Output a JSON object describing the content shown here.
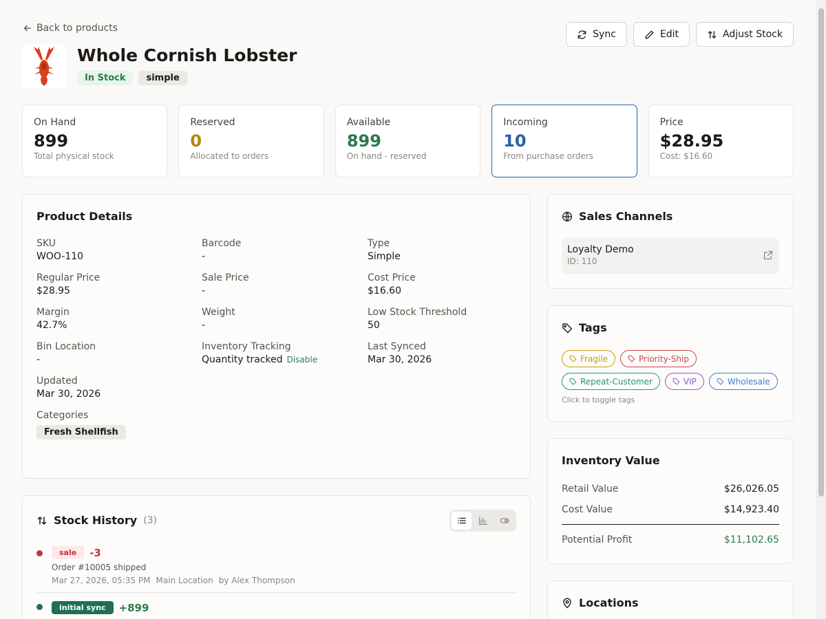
{
  "nav": {
    "back_label": "Back to products"
  },
  "actions": {
    "sync": "Sync",
    "edit": "Edit",
    "adjust": "Adjust Stock"
  },
  "product": {
    "name": "Whole Cornish Lobster",
    "status": "In Stock",
    "type_badge": "simple"
  },
  "stats": [
    {
      "label": "On Hand",
      "value": "899",
      "sub": "Total physical stock",
      "color": "#1c1917"
    },
    {
      "label": "Reserved",
      "value": "0",
      "sub": "Allocated to orders",
      "color": "#b8860b"
    },
    {
      "label": "Available",
      "value": "899",
      "sub": "On hand - reserved",
      "color": "#2b7a4b"
    },
    {
      "label": "Incoming",
      "value": "10",
      "sub": "From purchase orders",
      "color": "#2563a8"
    },
    {
      "label": "Price",
      "value": "$28.95",
      "sub": "Cost: $16.60",
      "color": "#1c1917"
    }
  ],
  "details": {
    "title": "Product Details",
    "sku": {
      "label": "SKU",
      "value": "WOO-110"
    },
    "barcode": {
      "label": "Barcode",
      "value": "-"
    },
    "type": {
      "label": "Type",
      "value": "Simple"
    },
    "regular_price": {
      "label": "Regular Price",
      "value": "$28.95"
    },
    "sale_price": {
      "label": "Sale Price",
      "value": "-"
    },
    "cost_price": {
      "label": "Cost Price",
      "value": "$16.60"
    },
    "margin": {
      "label": "Margin",
      "value": "42.7%"
    },
    "weight": {
      "label": "Weight",
      "value": "-"
    },
    "low_stock": {
      "label": "Low Stock Threshold",
      "value": "50"
    },
    "bin": {
      "label": "Bin Location",
      "value": "-"
    },
    "tracking": {
      "label": "Inventory Tracking",
      "value": "Quantity tracked",
      "action": "Disable"
    },
    "last_synced": {
      "label": "Last Synced",
      "value": "Mar 30, 2026"
    },
    "updated": {
      "label": "Updated",
      "value": "Mar 30, 2026"
    },
    "categories": {
      "label": "Categories",
      "value": "Fresh Shellfish"
    }
  },
  "history": {
    "title": "Stock History",
    "count": "(3)",
    "entries": [
      {
        "type": "sale",
        "delta": "-3",
        "desc": "Order #10005 shipped",
        "date": "Mar 27, 2026, 05:35 PM",
        "location": "Main Location",
        "user": "by Alex Thompson"
      },
      {
        "type": "initial sync",
        "delta": "+899"
      }
    ]
  },
  "channels": {
    "title": "Sales Channels",
    "items": [
      {
        "name": "Loyalty Demo",
        "id": "ID: 110"
      }
    ]
  },
  "tags": {
    "title": "Tags",
    "items": [
      {
        "label": "Fragile",
        "color": "#c99a06"
      },
      {
        "label": "Priority-Ship",
        "color": "#d0434c"
      },
      {
        "label": "Repeat-Customer",
        "color": "#1f9a76"
      },
      {
        "label": "VIP",
        "color": "#8b5cc7"
      },
      {
        "label": "Wholesale",
        "color": "#3b7fd0"
      }
    ],
    "hint": "Click to toggle tags"
  },
  "inventory_value": {
    "title": "Inventory Value",
    "retail": {
      "label": "Retail Value",
      "value": "$26,026.05"
    },
    "cost": {
      "label": "Cost Value",
      "value": "$14,923.40"
    },
    "profit": {
      "label": "Potential Profit",
      "value": "$11,102.65"
    }
  },
  "locations": {
    "title": "Locations"
  }
}
